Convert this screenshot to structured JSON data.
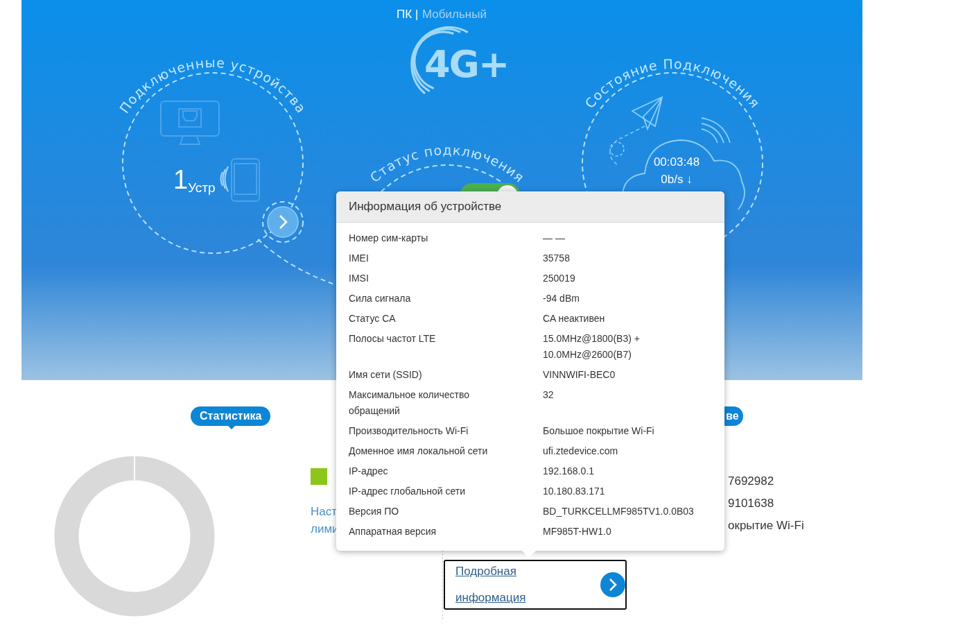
{
  "mode_switch": {
    "items": [
      {
        "label": "ПК",
        "selected": true
      },
      {
        "label": "Мобильный",
        "selected": false
      }
    ],
    "separator": "|"
  },
  "network_logo": "4G+",
  "connected_devices": {
    "title": "Подключенные устройства",
    "count": "1",
    "unit": "Устр"
  },
  "connection_status": {
    "title": "Статус подключения",
    "on": true
  },
  "connection_state": {
    "title": "Состояние Подключения",
    "duration": "00:03:48",
    "speed": "0b/s ↓"
  },
  "statistics": {
    "tab": "Статистика",
    "link_lines": [
      "Наст",
      "лими"
    ]
  },
  "device_panel": {
    "tab": "ве",
    "values": [
      "7692982",
      "9101638",
      "окрытие Wi-Fi"
    ],
    "details_link": "Подробная информация"
  },
  "device_info_popup": {
    "title": "Информация об устройстве",
    "rows": [
      {
        "label": "Номер сим-карты",
        "value": "— —"
      },
      {
        "label": "IMEI",
        "value": "35758"
      },
      {
        "label": "IMSI",
        "value": "250019"
      },
      {
        "label": "Сила сигнала",
        "value": "-94 dBm"
      },
      {
        "label": "Статус CA",
        "value": "CA неактивен"
      },
      {
        "label": "Полосы частот LTE",
        "value": "15.0MHz@1800(B3) + 10.0MHz@2600(B7)"
      },
      {
        "label": "Имя сети (SSID)",
        "value": "VINNWIFI-BEC0"
      },
      {
        "label": "Максимальное количество обращений",
        "value": "32"
      },
      {
        "label": "Производительность Wi-Fi",
        "value": "Большое покрытие Wi-Fi"
      },
      {
        "label": "Доменное имя локальной сети",
        "value": "ufi.ztedevice.com"
      },
      {
        "label": "IP-адрес",
        "value": "192.168.0.1"
      },
      {
        "label": "IP-адрес глобальной сети",
        "value": "10.180.83.171"
      },
      {
        "label": "Версия ПО",
        "value": "BD_TURKCELLMF985TV1.0.0B03"
      },
      {
        "label": "Аппаратная версия",
        "value": "MF985T-HW1.0"
      }
    ]
  }
}
